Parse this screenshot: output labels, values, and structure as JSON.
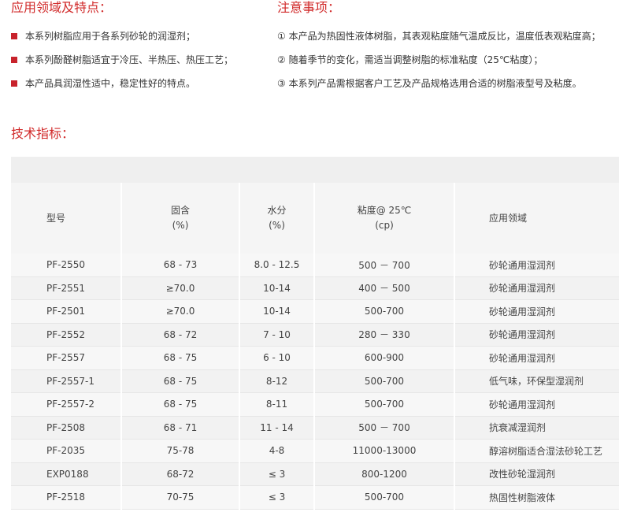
{
  "sections": {
    "application_title": "应用领域及特点：",
    "notes_title": "注意事项：",
    "spec_title": "技术指标："
  },
  "features": [
    "本系列树脂应用于各系列砂轮的润湿剂；",
    "本系列酚醛树脂适宜于冷压、半热压、热压工艺；",
    "本产品具润湿性适中，稳定性好的特点。"
  ],
  "notes": [
    "① 本产品为热固性液体树脂，其表观粘度随气温成反比，温度低表观粘度高；",
    "② 随着季节的变化，需适当调整树脂的标准粘度（25℃粘度）；",
    "③ 本系列产品需根据客户工艺及产品规格选用合适的树脂液型号及粘度。"
  ],
  "table": {
    "headers": {
      "model": "型号",
      "solid": "固含",
      "solid_unit": "(%)",
      "water": "水分",
      "water_unit": "(%)",
      "viscosity": "粘度@ 25℃",
      "viscosity_unit": "(cp)",
      "application": "应用领域"
    },
    "rows": [
      [
        "PF-2550",
        "68 - 73",
        "8.0 - 12.5",
        "500 － 700",
        "砂轮通用湿润剂"
      ],
      [
        "PF-2551",
        "≥70.0",
        "10-14",
        "400 － 500",
        "砂轮通用湿润剂"
      ],
      [
        "PF-2501",
        "≥70.0",
        "10-14",
        "500-700",
        "砂轮通用湿润剂"
      ],
      [
        "PF-2552",
        "68 - 72",
        "7 - 10",
        "280 － 330",
        "砂轮通用湿润剂"
      ],
      [
        "PF-2557",
        "68 - 75",
        "6 - 10",
        "600-900",
        "砂轮通用湿润剂"
      ],
      [
        "PF-2557-1",
        "68 - 75",
        "8-12",
        "500-700",
        "低气味，环保型湿润剂"
      ],
      [
        "PF-2557-2",
        "68 - 75",
        "8-11",
        "500-700",
        "砂轮通用湿润剂"
      ],
      [
        "PF-2508",
        "68 - 71",
        "11 - 14",
        "500 － 700",
        "抗衰减湿润剂"
      ],
      [
        "PF-2035",
        "75-78",
        "4-8",
        "11000-13000",
        "醇溶树脂适合湿法砂轮工艺"
      ],
      [
        "EXP0188",
        "68-72",
        "≤ 3",
        "800-1200",
        "改性砂轮湿润剂"
      ],
      [
        "PF-2518",
        "70-75",
        "≤ 3",
        "500-700",
        "热固性树脂液体"
      ]
    ]
  }
}
